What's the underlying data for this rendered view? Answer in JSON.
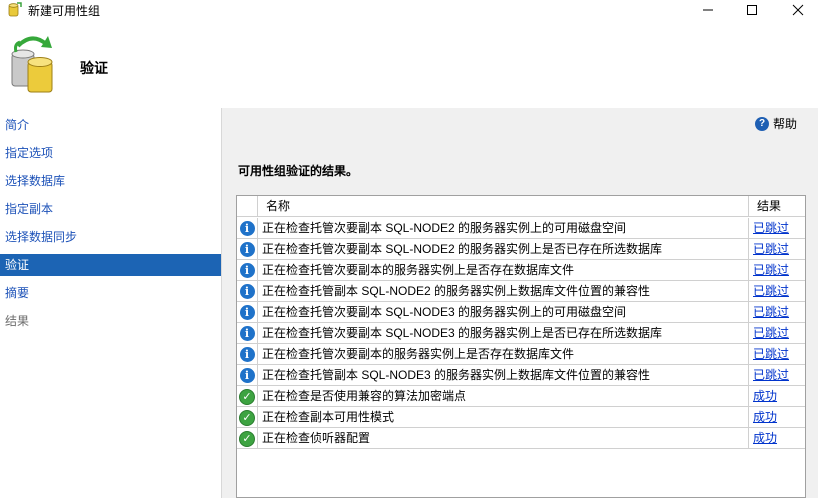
{
  "window": {
    "title": "新建可用性组",
    "minimize": "—",
    "maximize": "☐",
    "close": "✕"
  },
  "header": {
    "title": "验证",
    "icon": "database-refresh-icon"
  },
  "nav": {
    "items": [
      {
        "label": "简介",
        "state": "link"
      },
      {
        "label": "指定选项",
        "state": "link"
      },
      {
        "label": "选择数据库",
        "state": "link"
      },
      {
        "label": "指定副本",
        "state": "link"
      },
      {
        "label": "选择数据同步",
        "state": "link"
      },
      {
        "label": "验证",
        "state": "active"
      },
      {
        "label": "摘要",
        "state": "link"
      },
      {
        "label": "结果",
        "state": "disabled"
      }
    ]
  },
  "content": {
    "help_label": "帮助",
    "section_title": "可用性组验证的结果。",
    "columns": {
      "name": "名称",
      "result": "结果"
    },
    "rows": [
      {
        "icon": "info",
        "name": "正在检查托管次要副本 SQL-NODE2 的服务器实例上的可用磁盘空间",
        "result": "已跳过"
      },
      {
        "icon": "info",
        "name": "正在检查托管次要副本 SQL-NODE2 的服务器实例上是否已存在所选数据库",
        "result": "已跳过"
      },
      {
        "icon": "info",
        "name": "正在检查托管次要副本的服务器实例上是否存在数据库文件",
        "result": "已跳过"
      },
      {
        "icon": "info",
        "name": "正在检查托管副本 SQL-NODE2 的服务器实例上数据库文件位置的兼容性",
        "result": "已跳过"
      },
      {
        "icon": "info",
        "name": "正在检查托管次要副本 SQL-NODE3 的服务器实例上的可用磁盘空间",
        "result": "已跳过"
      },
      {
        "icon": "info",
        "name": "正在检查托管次要副本 SQL-NODE3 的服务器实例上是否已存在所选数据库",
        "result": "已跳过"
      },
      {
        "icon": "info",
        "name": "正在检查托管次要副本的服务器实例上是否存在数据库文件",
        "result": "已跳过"
      },
      {
        "icon": "info",
        "name": "正在检查托管副本 SQL-NODE3 的服务器实例上数据库文件位置的兼容性",
        "result": "已跳过"
      },
      {
        "icon": "success",
        "name": "正在检查是否使用兼容的算法加密端点",
        "result": "成功"
      },
      {
        "icon": "success",
        "name": "正在检查副本可用性模式",
        "result": "成功"
      },
      {
        "icon": "success",
        "name": "正在检查侦听器配置",
        "result": "成功"
      }
    ]
  }
}
